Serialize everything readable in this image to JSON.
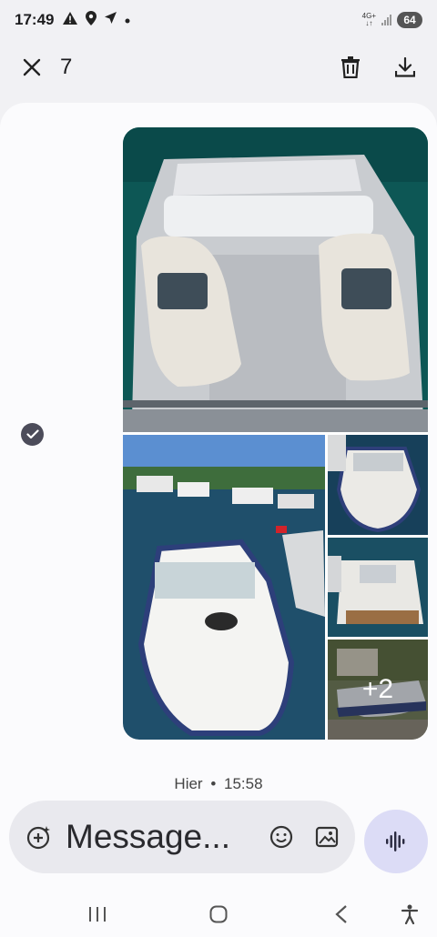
{
  "status_bar": {
    "time": "17:49",
    "network_type": "4G+",
    "battery": "64",
    "icons": [
      "alert-icon",
      "location-icon",
      "navigation-icon",
      "dot-icon"
    ]
  },
  "top_bar": {
    "selected_count": "7",
    "icons": [
      "close-icon",
      "delete-icon",
      "download-icon"
    ]
  },
  "gallery": {
    "photo_names": [
      "boat-cockpit-seats",
      "marina-boat-bow",
      "boat-top-view",
      "boat-deck-view",
      "boat-on-trailer"
    ],
    "more_count": "+2"
  },
  "message": {
    "day": "Hier",
    "time": "15:58"
  },
  "composer": {
    "placeholder": "Message...",
    "icons": [
      "add-attachment-icon",
      "emoji-icon",
      "gallery-icon",
      "voice-icon"
    ]
  },
  "nav_bar": {
    "icons": [
      "recents-icon",
      "home-icon",
      "back-icon",
      "accessibility-icon"
    ]
  },
  "colors": {
    "background": "#f1f1f4",
    "content": "#fbfbfd",
    "check": "#4c4c5a",
    "voice_button": "#dcdcf6"
  }
}
